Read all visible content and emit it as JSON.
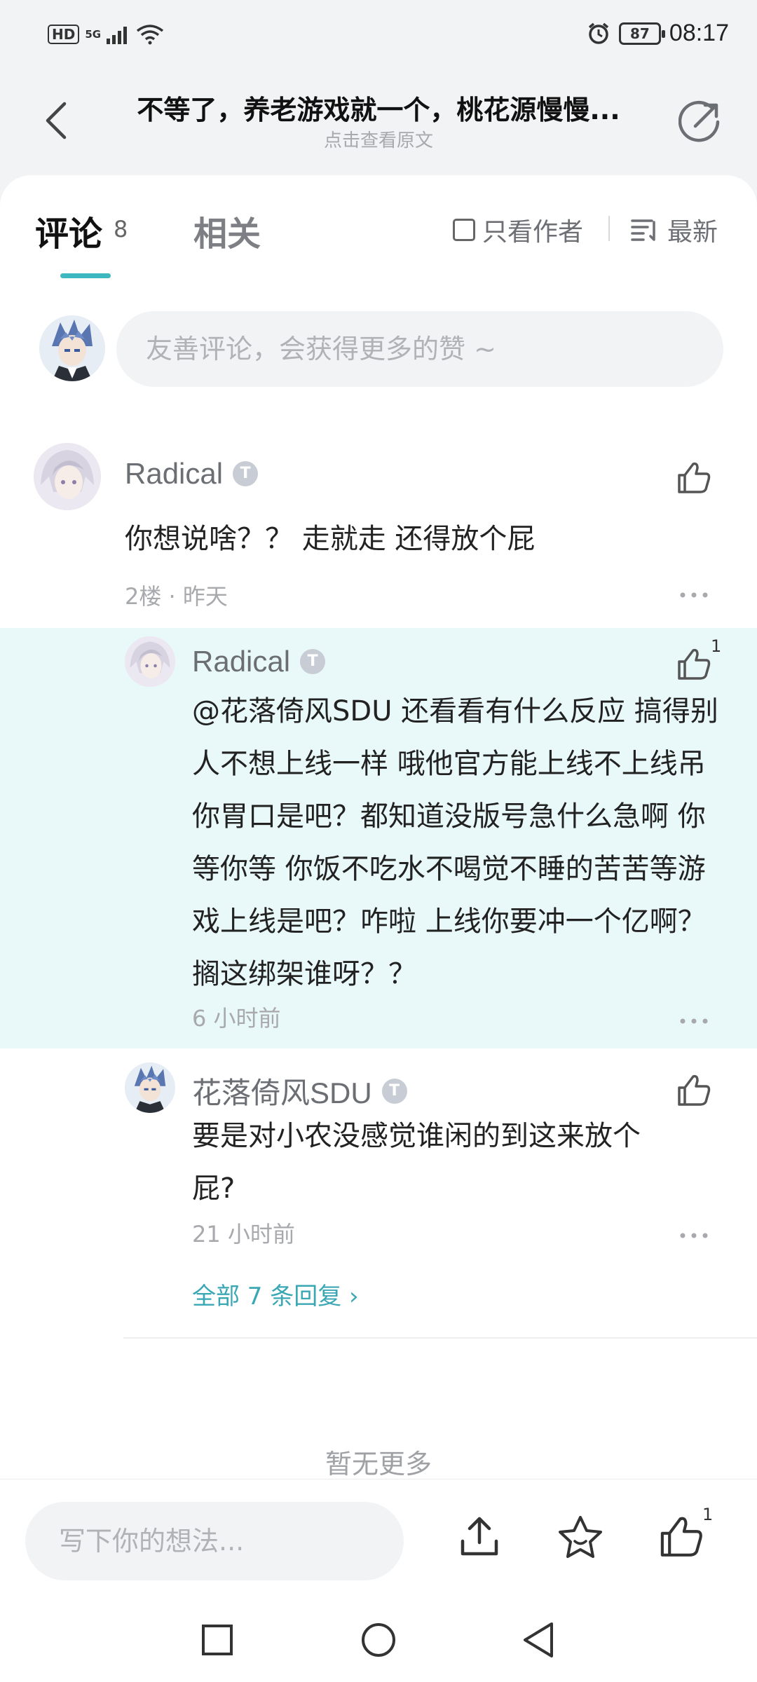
{
  "status_bar": {
    "hd": "HD",
    "network": "5G",
    "battery": "87",
    "time": "08:17"
  },
  "header": {
    "title": "不等了，养老游戏就一个，桃花源慢慢...",
    "subtitle": "点击查看原文"
  },
  "tabs": {
    "comments_label": "评论",
    "comments_count": "8",
    "related_label": "相关",
    "author_only_label": "只看作者",
    "sort_label": "最新"
  },
  "comment_box": {
    "placeholder": "友善评论，会获得更多的赞 ~"
  },
  "comment": {
    "username": "Radical",
    "badge": "T",
    "text": "你想说啥？？ 走就走 还得放个屁",
    "floor": "2楼 · 昨天"
  },
  "replies": [
    {
      "username": "Radical",
      "badge": "T",
      "text": "@花落倚风SDU  还看看有什么反应 搞得别人不想上线一样 哦他官方能上线不上线吊你胃口是吧？都知道没版号急什么急啊 你等你等 你饭不吃水不喝觉不睡的苦苦等游戏上线是吧？咋啦 上线你要冲一个亿啊？搁这绑架谁呀？？",
      "time": "6 小时前",
      "likes": "1"
    },
    {
      "username": "花落倚风SDU",
      "badge": "T",
      "text": "要是对小农没感觉谁闲的到这来放个屁?",
      "time": "21 小时前"
    }
  ],
  "all_replies_label": "全部 7 条回复 ›",
  "no_more": "暂无更多",
  "bottom_bar": {
    "placeholder": "写下你的想法...",
    "like_count": "1"
  },
  "colors": {
    "accent": "#3db7c0",
    "link": "#3aa7b4",
    "reply_highlight": "#e9f8f8"
  }
}
